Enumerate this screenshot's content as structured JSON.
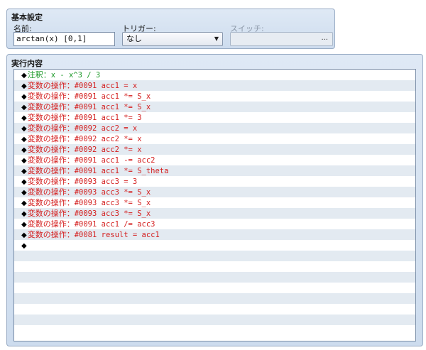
{
  "basic_settings": {
    "title": "基本設定",
    "name_label": "名前:",
    "name_value": "arctan(x) [0,1]",
    "trigger_label": "トリガー:",
    "trigger_value": "なし",
    "switch_label": "スイッチ:",
    "switch_button": "..."
  },
  "execution": {
    "title": "実行内容",
    "commands": [
      {
        "marker": "◆",
        "type": "comment",
        "prefix": "注釈：",
        "text": "x - x^3 / 3"
      },
      {
        "marker": "◆",
        "type": "variable",
        "prefix": "変数の操作：",
        "text": "#0091 acc1 = x"
      },
      {
        "marker": "◆",
        "type": "variable",
        "prefix": "変数の操作：",
        "text": "#0091 acc1 *= S_x"
      },
      {
        "marker": "◆",
        "type": "variable",
        "prefix": "変数の操作：",
        "text": "#0091 acc1 *= S_x"
      },
      {
        "marker": "◆",
        "type": "variable",
        "prefix": "変数の操作：",
        "text": "#0091 acc1 *= 3"
      },
      {
        "marker": "◆",
        "type": "variable",
        "prefix": "変数の操作：",
        "text": "#0092 acc2 = x"
      },
      {
        "marker": "◆",
        "type": "variable",
        "prefix": "変数の操作：",
        "text": "#0092 acc2 *= x"
      },
      {
        "marker": "◆",
        "type": "variable",
        "prefix": "変数の操作：",
        "text": "#0092 acc2 *= x"
      },
      {
        "marker": "◆",
        "type": "variable",
        "prefix": "変数の操作：",
        "text": "#0091 acc1 -= acc2"
      },
      {
        "marker": "◆",
        "type": "variable",
        "prefix": "変数の操作：",
        "text": "#0091 acc1 *= S_theta"
      },
      {
        "marker": "◆",
        "type": "variable",
        "prefix": "変数の操作：",
        "text": "#0093 acc3 = 3"
      },
      {
        "marker": "◆",
        "type": "variable",
        "prefix": "変数の操作：",
        "text": "#0093 acc3 *= S_x"
      },
      {
        "marker": "◆",
        "type": "variable",
        "prefix": "変数の操作：",
        "text": "#0093 acc3 *= S_x"
      },
      {
        "marker": "◆",
        "type": "variable",
        "prefix": "変数の操作：",
        "text": "#0093 acc3 *= S_x"
      },
      {
        "marker": "◆",
        "type": "variable",
        "prefix": "変数の操作：",
        "text": "#0091 acc1 /= acc3"
      },
      {
        "marker": "◆",
        "type": "variable",
        "prefix": "変数の操作：",
        "text": "#0081 result = acc1"
      },
      {
        "marker": "◆",
        "type": "empty",
        "prefix": "",
        "text": ""
      }
    ]
  },
  "colors": {
    "comment": "#1e9a2a",
    "variable": "#d42020",
    "stripe": "#e3eaf1"
  }
}
